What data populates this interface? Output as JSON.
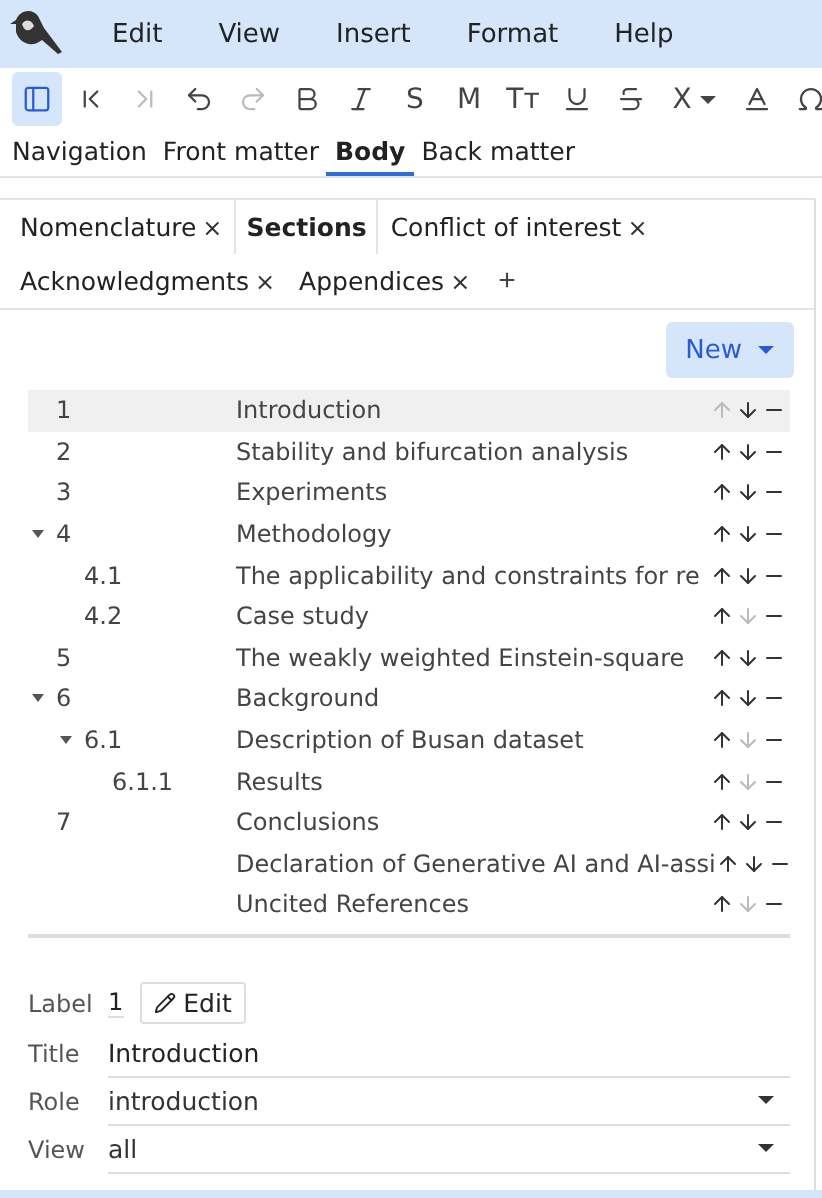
{
  "menu": [
    "Edit",
    "View",
    "Insert",
    "Format",
    "Help"
  ],
  "toolbar": [
    {
      "kind": "icon",
      "selected": true,
      "disabled": false
    },
    {
      "kind": "icon",
      "selected": false,
      "disabled": false
    },
    {
      "kind": "icon",
      "selected": false,
      "disabled": true
    },
    {
      "kind": "icon",
      "selected": false,
      "disabled": false
    },
    {
      "kind": "icon",
      "selected": false,
      "disabled": true
    },
    {
      "kind": "icon",
      "selected": false,
      "disabled": false
    },
    {
      "kind": "icon",
      "selected": false,
      "disabled": false
    },
    {
      "kind": "glyph",
      "text": "S",
      "selected": false,
      "disabled": false
    },
    {
      "kind": "glyph",
      "text": "M",
      "selected": false,
      "disabled": false
    },
    {
      "kind": "glyph",
      "text": "Tт",
      "selected": false,
      "disabled": false
    },
    {
      "kind": "icon",
      "selected": false,
      "disabled": false
    },
    {
      "kind": "icon",
      "selected": false,
      "disabled": false
    },
    {
      "kind": "glyph",
      "text": "X",
      "selected": false,
      "disabled": false
    },
    {
      "kind": "icon",
      "selected": false,
      "disabled": false
    },
    {
      "kind": "icon",
      "selected": false,
      "disabled": false
    }
  ],
  "tabs": [
    {
      "label": "Navigation",
      "selected": false
    },
    {
      "label": "Front matter",
      "selected": false
    },
    {
      "label": "Body",
      "selected": true
    },
    {
      "label": "Back matter",
      "selected": false
    }
  ],
  "subtabs": [
    {
      "label": "Nomenclature",
      "selected": false,
      "close": "×"
    },
    {
      "label": "Sections",
      "selected": true
    },
    {
      "label": "Conflict of interest",
      "selected": false,
      "close": "×"
    },
    {
      "label": "Acknowledgments",
      "selected": false,
      "close": "×"
    },
    {
      "label": "Appendices",
      "selected": false,
      "close": "×"
    }
  ],
  "add_tab": "+",
  "new_button": "New",
  "sections": [
    {
      "number": "1",
      "title": "Introduction",
      "selected": true,
      "up_disabled": true,
      "down_disabled": false
    },
    {
      "number": "2",
      "title": "Stability and bifurcation analysis",
      "selected": false,
      "up_disabled": false,
      "down_disabled": false
    },
    {
      "number": "3",
      "title": "Experiments",
      "selected": false,
      "up_disabled": false,
      "down_disabled": false
    },
    {
      "number": "4",
      "title": "Methodology",
      "selected": false,
      "up_disabled": false,
      "down_disabled": false,
      "expanded": true,
      "children": [
        {
          "number": "4.1",
          "title": "The applicability and constraints for re",
          "selected": false,
          "up_disabled": false,
          "down_disabled": false
        },
        {
          "number": "4.2",
          "title": "Case study",
          "selected": false,
          "up_disabled": false,
          "down_disabled": true
        }
      ]
    },
    {
      "number": "5",
      "title": "The weakly weighted Einstein-square",
      "selected": false,
      "up_disabled": false,
      "down_disabled": false
    },
    {
      "number": "6",
      "title": "Background",
      "selected": false,
      "up_disabled": false,
      "down_disabled": false,
      "expanded": true,
      "children": [
        {
          "number": "6.1",
          "title": "Description of Busan dataset",
          "selected": false,
          "up_disabled": false,
          "down_disabled": true,
          "expanded": true,
          "children": [
            {
              "number": "6.1.1",
              "title": "Results",
              "selected": false,
              "up_disabled": false,
              "down_disabled": true
            }
          ]
        }
      ]
    },
    {
      "number": "7",
      "title": "Conclusions",
      "selected": false,
      "up_disabled": false,
      "down_disabled": false
    },
    {
      "title": "Declaration of Generative AI and AI-assi",
      "selected": false,
      "up_disabled": false,
      "down_disabled": false
    },
    {
      "title": "Uncited References",
      "selected": false,
      "up_disabled": false,
      "down_disabled": true
    }
  ],
  "form": {
    "label": {
      "caption": "Label",
      "value": "1",
      "button": "Edit"
    },
    "title": {
      "caption": "Title",
      "value": "Introduction"
    },
    "role": {
      "caption": "Role",
      "value": "introduction"
    },
    "view": {
      "caption": "View",
      "value": "all"
    }
  }
}
